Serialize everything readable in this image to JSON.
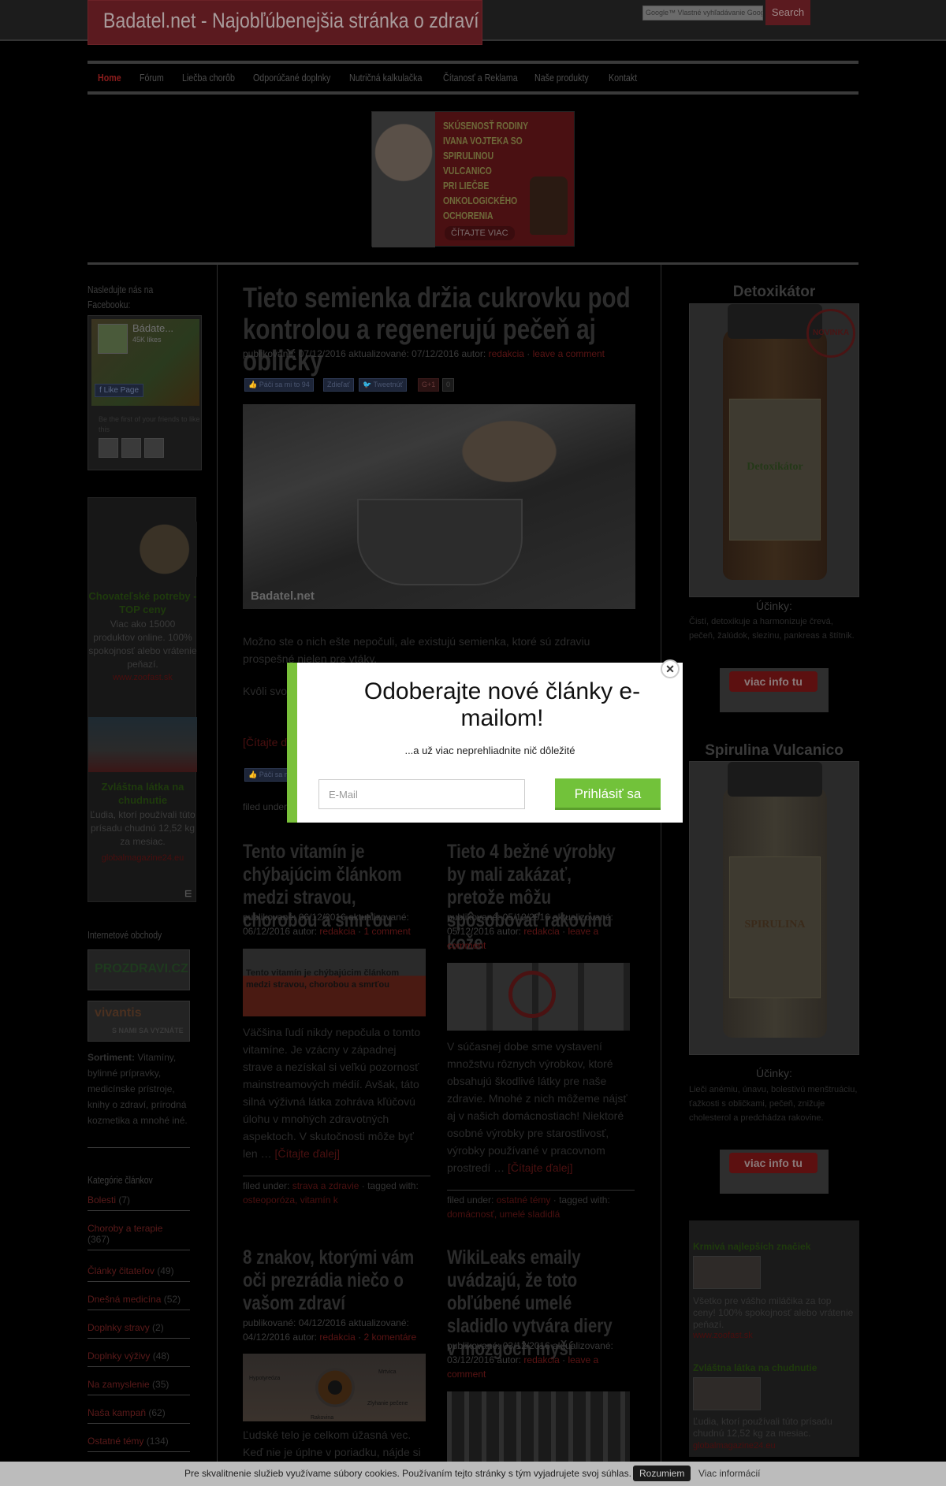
{
  "site": {
    "logo": "Badatel.net - Najobľúbenejšia stránka o zdraví",
    "search_placeholder": "Vlastné vyhľadávanie Google",
    "search_prefix": "Google™",
    "search_button": "Search"
  },
  "nav": [
    "Home",
    "Fórum",
    "Liečba chorôb",
    "Odporúčané doplnky",
    "Nutričná kalkulačka",
    "Čítanosť a Reklama",
    "Naše produkty",
    "Kontakt"
  ],
  "banner": {
    "lines": [
      "SKÚSENOSŤ RODINY",
      "IVANA VOJTEKA SO",
      "SPIRULINOU",
      "VULCANICO",
      "PRI LIEČBE",
      "ONKOLOGICKÉHO",
      "OCHORENIA"
    ],
    "button": "ČÍTAJTE VIAC"
  },
  "left": {
    "fb_heading": "Nasledujte nás na Facebooku:",
    "fb_name": "Bádate...",
    "fb_likes": "45K likes",
    "fb_like_btn": "Like Page",
    "fb_first": "Be the first of your friends to like this",
    "ad1": {
      "title": "Chovateľské potreby - TOP ceny",
      "text": "Viac ako 15000 produktov online. 100% spokojnosť alebo vrátenie peňazí.",
      "url": "www.zoofast.sk"
    },
    "ad2": {
      "title": "Zvláštna látka na chudnutie",
      "text": "Ľudia, ktorí používali túto prísadu chudnú 12,52 kg za mesiac.",
      "url": "globalmagazine24.eu"
    },
    "shops_heading": "Internetové obchody",
    "shop1": "PROZDRAVI.CZ",
    "shop2": "vivantis",
    "shop2_sub": "S NAMI SA VYZNÁTE",
    "sortiment_label": "Sortiment:",
    "sortiment_text": "Vitamíny, bylinné prípravky, medicínske prístroje, knihy o zdraví, prírodná kozmetika a mnohé iné.",
    "cat_heading": "Kategórie článkov",
    "categories": [
      {
        "name": "Bolesti",
        "count": "(7)"
      },
      {
        "name": "Choroby a terapie",
        "count": "(367)"
      },
      {
        "name": "Články čitateľov",
        "count": "(49)"
      },
      {
        "name": "Dnešná medicína",
        "count": "(52)"
      },
      {
        "name": "Doplnky stravy",
        "count": "(2)"
      },
      {
        "name": "Doplnky výživy",
        "count": "(48)"
      },
      {
        "name": "Na zamyslenie",
        "count": "(35)"
      },
      {
        "name": "Naša kampaň",
        "count": "(62)"
      },
      {
        "name": "Ostatné témy",
        "count": "(134)"
      }
    ]
  },
  "main_post": {
    "title": "Tieto semienka držia cukrovku pod kontrolou a regenerujú pečeň aj obličky",
    "meta_prefix": "publikované: 07/12/2016 aktualizované: 07/12/2016 autor:",
    "author": "redakcia",
    "comment": "leave a comment",
    "share": [
      "Páči sa mi to 94",
      "Zdieľať",
      "Tweetnúť",
      "G+1",
      "0"
    ],
    "watermark": "Badatel.net",
    "p1": "Možno ste o nich ešte nepočuli, ale existujú semienka, ktoré sú zdraviu prospešné nielen pre vtáky.",
    "p2": "Kvôli svojim vlastnostiam sú vhodné na prípravu čajov, kaší a užitočných liečivých kúr.",
    "readmore": "[Čítajte ďalej]",
    "filed": "filed under:"
  },
  "posts": [
    {
      "title": "Tento vitamín je chýbajúcim článkom medzi stravou, chorobou a smrťou",
      "meta": "publikované: 06/12/2016 aktualizované: 06/12/2016 autor:",
      "author": "redakcia",
      "comment": "1 comment",
      "thumb_caption": "Tento vitamín je chýbajúcim článkom medzi stravou, chorobou a smrťou",
      "excerpt": "Väčšina ľudí nikdy nepočula o tomto vitamíne. Je vzácny v západnej strave a nezískal si veľkú pozornosť mainstreamových médií. Avšak, táto silná výživná látka zohráva kľúčovú úlohu v mnohých zdravotných aspektoch. V skutočnosti môže byť len …",
      "readmore": "[Čítajte ďalej]",
      "filed_label": "filed under:",
      "filed_cat": "strava a zdravie",
      "tagged_label": "tagged with:",
      "tags": "osteoporóza, vitamín k"
    },
    {
      "title": "Tieto 4 bežné výrobky by mali zakázať, pretože môžu spôsobovať rakovinu kože",
      "meta": "publikované: 05/12/2016 aktualizované: 05/12/2016 autor:",
      "author": "redakcia",
      "comment": "leave a comment",
      "excerpt": "V súčasnej dobe sme vystavení množstvu rôznych výrobkov, ktoré obsahujú škodlivé látky pre naše zdravie. Mnohé z nich môžeme nájsť aj v našich domácnostiach! Niektoré osobné výrobky pre starostlivosť, výrobky používané v pracovnom prostredí …",
      "readmore": "[Čítajte ďalej]",
      "filed_label": "filed under:",
      "filed_cat": "ostatné témy",
      "tagged_label": "tagged with:",
      "tags": "domácnosť, umelé sladidlá"
    },
    {
      "title": "8 znakov, ktorými vám oči prezrádia niečo o vašom zdraví",
      "meta": "publikované: 04/12/2016 aktualizované: 04/12/2016 autor:",
      "author": "redakcia",
      "comment": "2 komentáre",
      "excerpt": "Ľudské telo je celkom úžasná vec. Keď nie je úplne v poriadku, nájde si",
      "eye_labels": [
        "Hypotyreóza",
        "Mrtvica",
        "Zlyhanie pečene",
        "Rakovina"
      ]
    },
    {
      "title": "WikiLeaks emaily uvádzajú, že toto obľúbené umelé sladidlo vytvára diery v mozgoch myší",
      "meta": "publikované: 03/12/2016 aktualizované: 03/12/2016 autor:",
      "author": "redakcia",
      "comment": "leave a comment"
    }
  ],
  "right": {
    "p1_title": "Detoxikátor",
    "p1_badge": "NOVINKA",
    "p1_label": "Detoxikátor",
    "p1_effects_h": "Účinky:",
    "p1_effects": "Čistí, detoxikuje a harmonizuje črevá, pečeň, žalúdok, slezinu, pankreas a štítnik.",
    "button": "viac info tu",
    "p2_title": "Spirulina Vulcanico",
    "p2_label": "SPIRULINA",
    "p2_effects_h": "Účinky:",
    "p2_effects": "Lieči anémiu, únavu, bolestivú menštruáciu, ťažkosti s obličkami, pečeň, znižuje cholesterol a predchádza rakovine.",
    "ad1": {
      "title": "Krmivá najlepších značiek",
      "text": "Všetko pre vášho miláčika za top ceny! 100% spokojnosť alebo vrátenie peňazí.",
      "url": "www.zoofast.sk"
    },
    "ad2": {
      "title": "Zvláštna látka na chudnutie",
      "text": "Ľudia, ktorí používali túto prísadu chudnú 12,52 kg za mesiac.",
      "url": "globalmagazine24.eu"
    }
  },
  "modal": {
    "title": "Odoberajte nové články e-mailom!",
    "subtitle": "...a už viac neprehliadnite nič dôležité",
    "email_placeholder": "E-Mail",
    "button": "Prihlásiť sa",
    "close": "✕"
  },
  "cookie": {
    "text": "Pre skvalitnenie služieb využívame súbory cookies. Používaním tejto stránky s tým vyjadrujete svoj súhlas.",
    "ok": "Rozumiem",
    "more": "Viac informácií"
  }
}
